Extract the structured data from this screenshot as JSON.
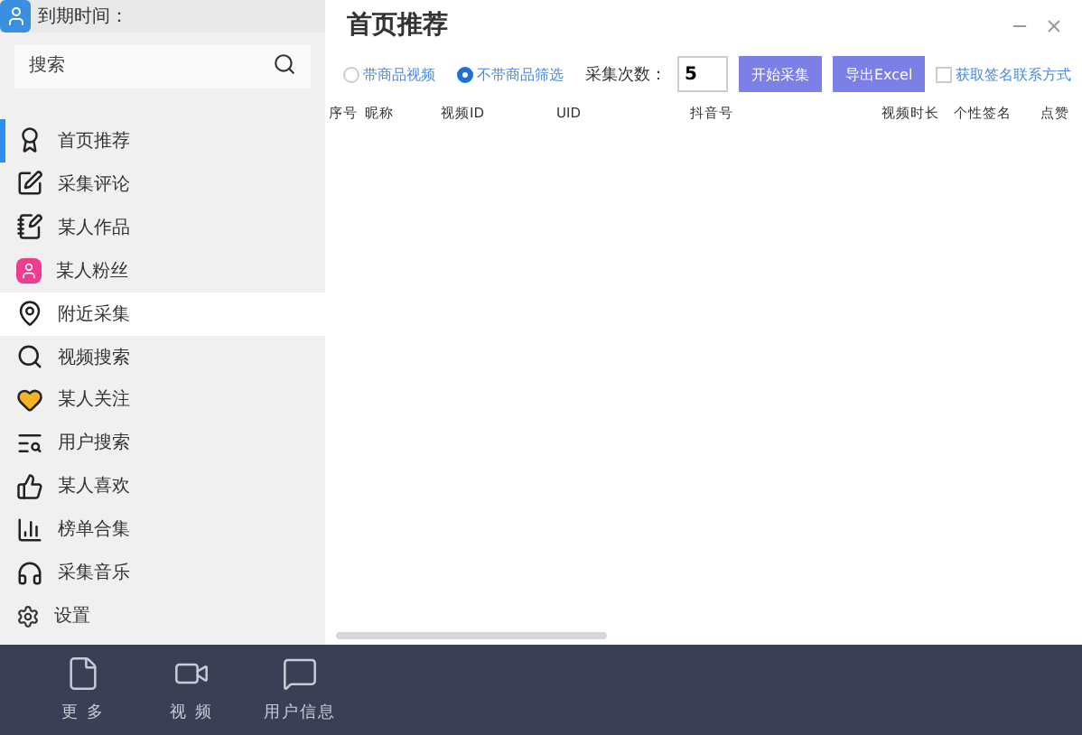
{
  "sidebar": {
    "expiry_label": "到期时间：",
    "search": {
      "placeholder": "搜索"
    },
    "items": [
      {
        "label": "首页推荐",
        "selected": true,
        "hovered": false
      },
      {
        "label": "采集评论",
        "selected": false,
        "hovered": false
      },
      {
        "label": "某人作品",
        "selected": false,
        "hovered": false
      },
      {
        "label": "某人粉丝",
        "selected": false,
        "hovered": false
      },
      {
        "label": "附近采集",
        "selected": false,
        "hovered": true
      },
      {
        "label": "视频搜索",
        "selected": false,
        "hovered": false
      },
      {
        "label": "某人关注",
        "selected": false,
        "hovered": false
      },
      {
        "label": "用户搜索",
        "selected": false,
        "hovered": false
      },
      {
        "label": "某人喜欢",
        "selected": false,
        "hovered": false
      },
      {
        "label": "榜单合集",
        "selected": false,
        "hovered": false
      },
      {
        "label": "采集音乐",
        "selected": false,
        "hovered": false
      }
    ],
    "settings": "设置"
  },
  "main": {
    "title": "首页推荐",
    "filters": [
      {
        "label": "带商品视频",
        "selected": false
      },
      {
        "label": "不带商品筛选",
        "selected": true
      }
    ],
    "count_label": "采集次数：",
    "count_value": "5",
    "buttons": [
      "开始采集",
      "导出Excel"
    ],
    "signature_option": {
      "label": "获取签名联系方式",
      "checked": false
    },
    "table": {
      "columns": [
        "序号",
        "昵称",
        "视频ID",
        "UID",
        "抖音号",
        "视频时长",
        "个性签名",
        "点赞"
      ]
    }
  },
  "bottom_nav": [
    {
      "label": "更 多"
    },
    {
      "label": "视 频"
    },
    {
      "label": "用户信息"
    }
  ]
}
